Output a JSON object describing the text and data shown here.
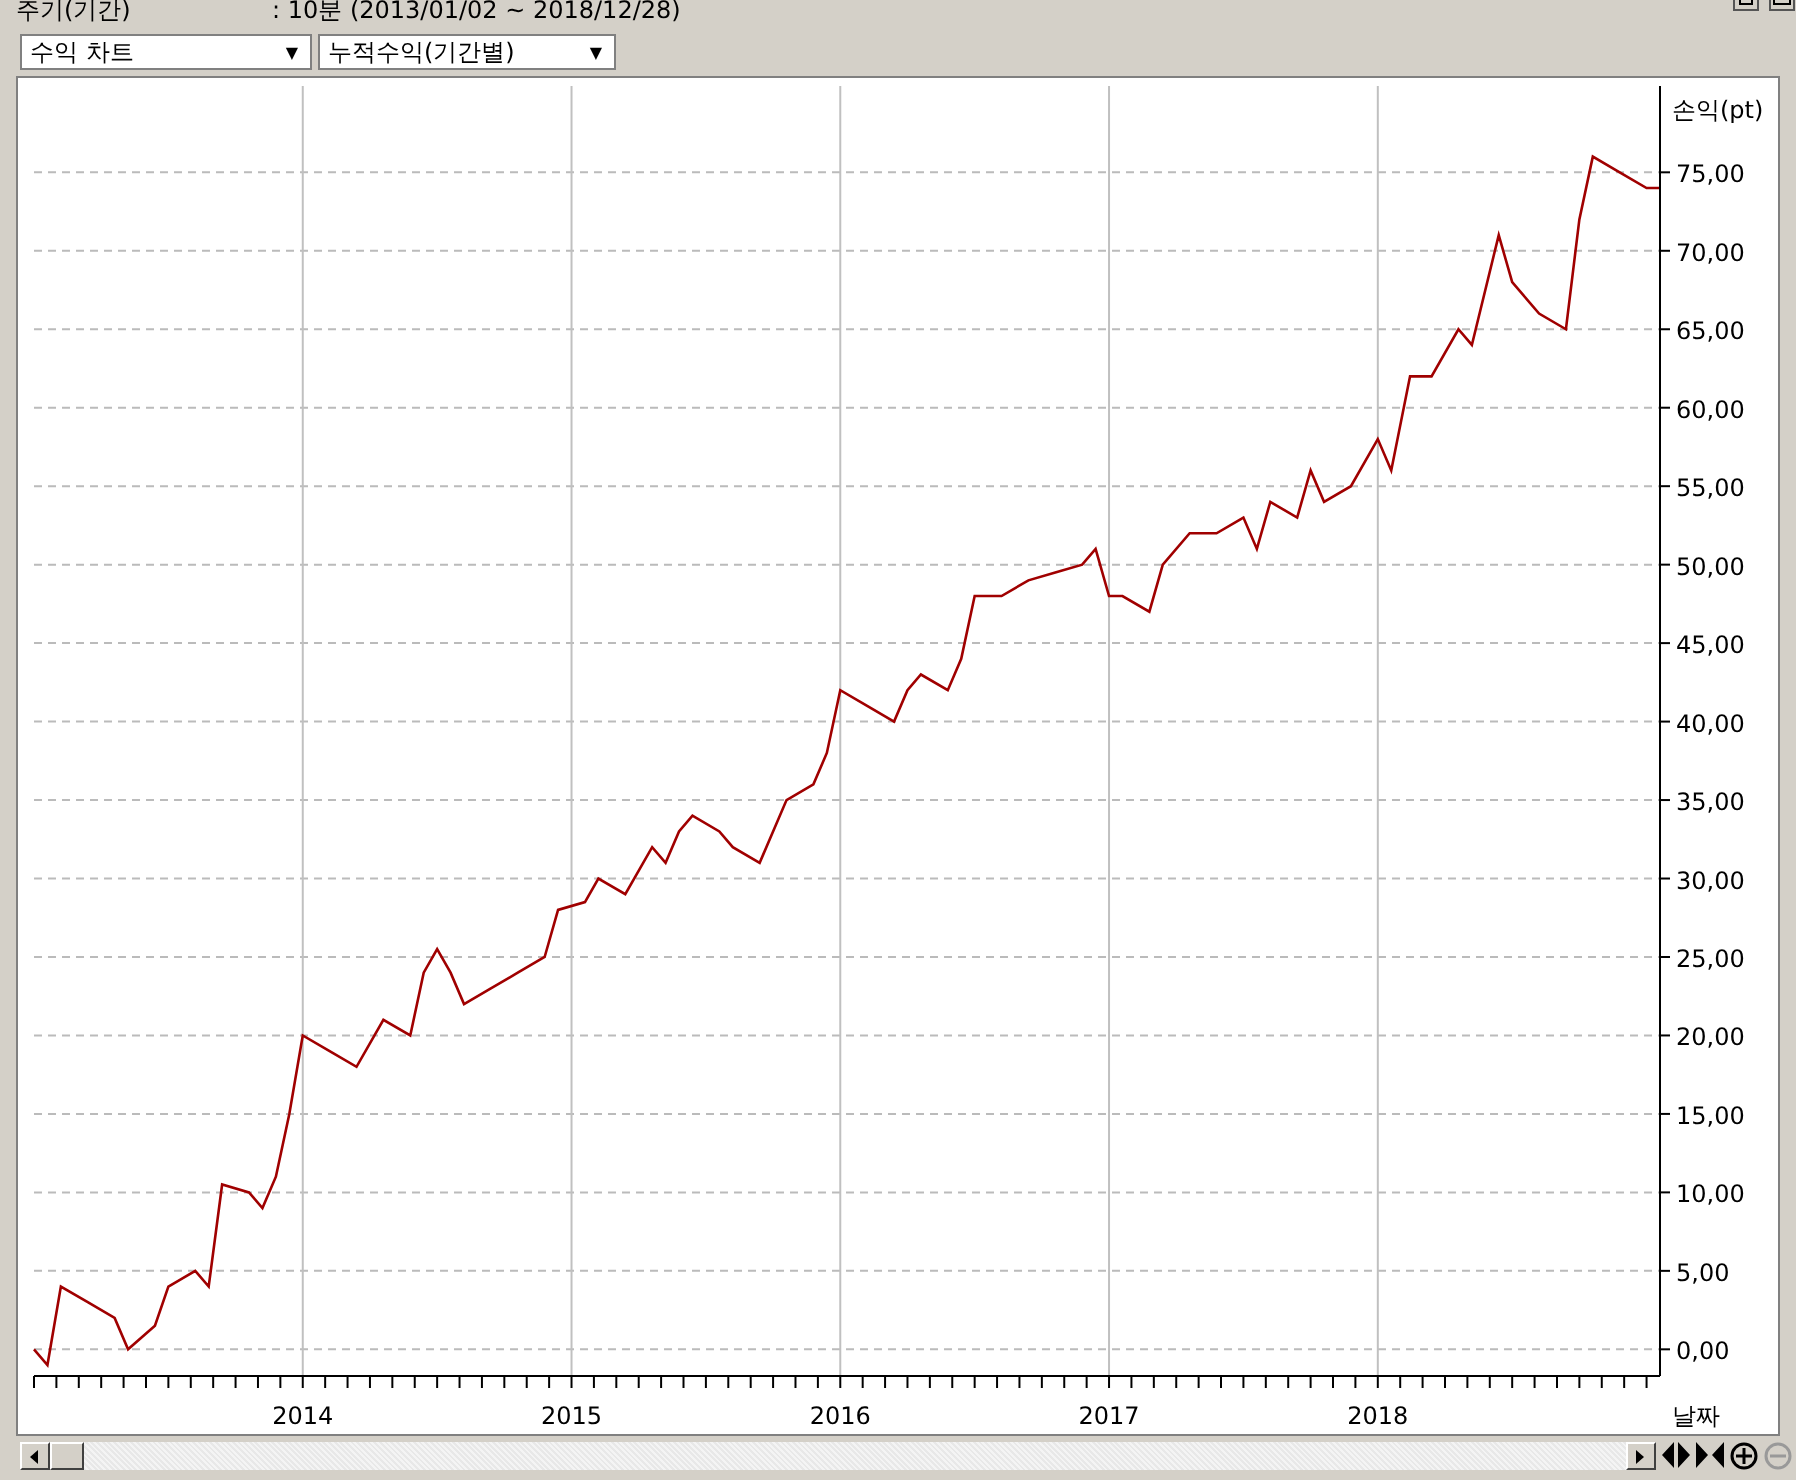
{
  "header": {
    "period_label": "주기(기간)",
    "period_value": ": 10분  (2013/01/02 ~ 2018/12/28)"
  },
  "selectors": [
    {
      "value": "수익 차트",
      "glyph": "▼"
    },
    {
      "value": "누적수익(기간별)",
      "glyph": "▼"
    }
  ],
  "chart": {
    "chart_data": {
      "type": "line",
      "grid": true,
      "ylabel": "손익(pt)",
      "xlabel": "날짜",
      "xlim": [
        2013.0,
        2019.05
      ],
      "ylim": [
        -1.7,
        80.5
      ],
      "xticks": [
        {
          "value": 2014,
          "label": "2014"
        },
        {
          "value": 2015,
          "label": "2015"
        },
        {
          "value": 2016,
          "label": "2016"
        },
        {
          "value": 2017,
          "label": "2017"
        },
        {
          "value": 2018,
          "label": "2018"
        }
      ],
      "yticks": [
        {
          "value": 0,
          "label": "0,00"
        },
        {
          "value": 5,
          "label": "5,00"
        },
        {
          "value": 10,
          "label": "10,00"
        },
        {
          "value": 15,
          "label": "15,00"
        },
        {
          "value": 20,
          "label": "20,00"
        },
        {
          "value": 25,
          "label": "25,00"
        },
        {
          "value": 30,
          "label": "30,00"
        },
        {
          "value": 35,
          "label": "35,00"
        },
        {
          "value": 40,
          "label": "40,00"
        },
        {
          "value": 45,
          "label": "45,00"
        },
        {
          "value": 50,
          "label": "50,00"
        },
        {
          "value": 55,
          "label": "55,00"
        },
        {
          "value": 60,
          "label": "60,00"
        },
        {
          "value": 65,
          "label": "65,00"
        },
        {
          "value": 70,
          "label": "70,00"
        },
        {
          "value": 75,
          "label": "75,00"
        }
      ],
      "x": [
        2013.0,
        2013.05,
        2013.1,
        2013.2,
        2013.3,
        2013.35,
        2013.45,
        2013.5,
        2013.6,
        2013.65,
        2013.7,
        2013.8,
        2013.85,
        2013.9,
        2013.95,
        2014.0,
        2014.1,
        2014.2,
        2014.3,
        2014.4,
        2014.45,
        2014.5,
        2014.55,
        2014.6,
        2014.7,
        2014.8,
        2014.9,
        2014.95,
        2015.05,
        2015.1,
        2015.2,
        2015.3,
        2015.35,
        2015.4,
        2015.45,
        2015.55,
        2015.6,
        2015.7,
        2015.8,
        2015.9,
        2015.95,
        2016.0,
        2016.1,
        2016.2,
        2016.25,
        2016.3,
        2016.4,
        2016.45,
        2016.5,
        2016.6,
        2016.7,
        2016.8,
        2016.9,
        2016.95,
        2017.0,
        2017.05,
        2017.15,
        2017.2,
        2017.3,
        2017.4,
        2017.5,
        2017.55,
        2017.6,
        2017.7,
        2017.75,
        2017.8,
        2017.9,
        2018.0,
        2018.05,
        2018.12,
        2018.2,
        2018.3,
        2018.35,
        2018.45,
        2018.5,
        2018.6,
        2018.7,
        2018.75,
        2018.8,
        2018.9,
        2019.0,
        2019.05
      ],
      "series": [
        {
          "color": "#a00000",
          "values": [
            0,
            -1,
            4,
            3,
            2,
            0,
            1.5,
            4,
            5,
            4,
            10.5,
            10,
            9,
            11,
            15,
            20,
            19,
            18,
            21,
            20,
            24,
            25.5,
            24,
            22,
            23,
            24,
            25,
            28,
            28.5,
            30,
            29,
            32,
            31,
            33,
            34,
            33,
            32,
            31,
            35,
            36,
            38,
            42,
            41,
            40,
            42,
            43,
            42,
            44,
            48,
            48,
            49,
            49.5,
            50,
            51,
            48,
            48,
            47,
            50,
            52,
            52,
            53,
            51,
            54,
            53,
            56,
            54,
            55,
            58,
            56,
            62,
            62,
            65,
            64,
            71,
            68,
            66,
            65,
            72,
            76,
            75,
            74,
            74
          ]
        }
      ]
    }
  }
}
